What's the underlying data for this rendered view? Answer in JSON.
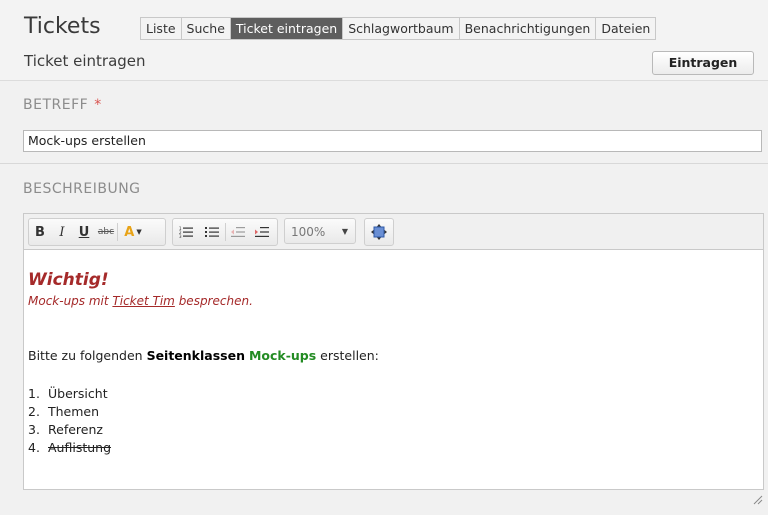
{
  "header": {
    "app_title": "Tickets",
    "subtitle": "Ticket eintragen",
    "tabs": [
      {
        "label": "Liste"
      },
      {
        "label": "Suche"
      },
      {
        "label": "Ticket eintragen",
        "active": true
      },
      {
        "label": "Schlagwortbaum"
      },
      {
        "label": "Benachrichtigungen"
      },
      {
        "label": "Dateien"
      }
    ],
    "submit_label": "Eintragen"
  },
  "form": {
    "subject_label": "BETREFF",
    "required_marker": "*",
    "subject_value": "Mock-ups erstellen",
    "description_label": "BESCHREIBUNG"
  },
  "toolbar": {
    "bold": "B",
    "italic": "I",
    "underline": "U",
    "strike": "abc",
    "font_color_icon": "A",
    "zoom": "100%"
  },
  "editor": {
    "warning": "Wichtig!",
    "note_prefix": "Mock-ups mit ",
    "note_link": "Ticket Tim",
    "note_suffix": " besprechen.",
    "intro_prefix": "Bitte zu folgenden ",
    "intro_bold": "Seitenklassen",
    "intro_green": "Mock-ups",
    "intro_suffix": " erstellen:",
    "list": [
      {
        "num": "1.",
        "text": "Übersicht"
      },
      {
        "num": "2.",
        "text": "Themen"
      },
      {
        "num": "3.",
        "text": "Referenz"
      },
      {
        "num": "4.",
        "text": "Auflistung",
        "strikethrough": true
      }
    ]
  },
  "colors": {
    "accent_active_tab": "#5e5e5e",
    "warning_red": "#a52a2a",
    "green_text": "#228b22",
    "required_red": "#d9534f"
  }
}
